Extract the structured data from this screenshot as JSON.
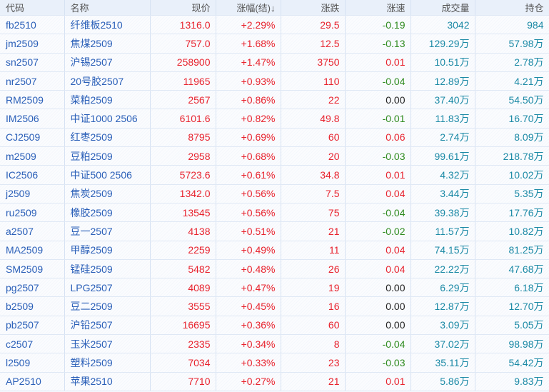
{
  "columns": [
    "代码",
    "名称",
    "现价",
    "涨幅(结)↓",
    "涨跌",
    "涨速",
    "成交量",
    "持仓"
  ],
  "rows": [
    [
      "fb2510",
      "纤维板2510",
      "1316.0",
      "+2.29%",
      "29.5",
      "-0.19",
      "3042",
      "984"
    ],
    [
      "jm2509",
      "焦煤2509",
      "757.0",
      "+1.68%",
      "12.5",
      "-0.13",
      "129.29万",
      "57.98万"
    ],
    [
      "sn2507",
      "沪锡2507",
      "258900",
      "+1.47%",
      "3750",
      "0.01",
      "10.51万",
      "2.78万"
    ],
    [
      "nr2507",
      "20号胶2507",
      "11965",
      "+0.93%",
      "110",
      "-0.04",
      "12.89万",
      "4.21万"
    ],
    [
      "RM2509",
      "菜粕2509",
      "2567",
      "+0.86%",
      "22",
      "0.00",
      "37.40万",
      "54.50万"
    ],
    [
      "IM2506",
      "中证1000 2506",
      "6101.6",
      "+0.82%",
      "49.8",
      "-0.01",
      "11.83万",
      "16.70万"
    ],
    [
      "CJ2509",
      "红枣2509",
      "8795",
      "+0.69%",
      "60",
      "0.06",
      "2.74万",
      "8.09万"
    ],
    [
      "m2509",
      "豆粕2509",
      "2958",
      "+0.68%",
      "20",
      "-0.03",
      "99.61万",
      "218.78万"
    ],
    [
      "IC2506",
      "中证500 2506",
      "5723.6",
      "+0.61%",
      "34.8",
      "0.01",
      "4.32万",
      "10.02万"
    ],
    [
      "j2509",
      "焦炭2509",
      "1342.0",
      "+0.56%",
      "7.5",
      "0.04",
      "3.44万",
      "5.35万"
    ],
    [
      "ru2509",
      "橡胶2509",
      "13545",
      "+0.56%",
      "75",
      "-0.04",
      "39.38万",
      "17.76万"
    ],
    [
      "a2507",
      "豆一2507",
      "4138",
      "+0.51%",
      "21",
      "-0.02",
      "11.57万",
      "10.82万"
    ],
    [
      "MA2509",
      "甲醇2509",
      "2259",
      "+0.49%",
      "11",
      "0.04",
      "74.15万",
      "81.25万"
    ],
    [
      "SM2509",
      "锰硅2509",
      "5482",
      "+0.48%",
      "26",
      "0.04",
      "22.22万",
      "47.68万"
    ],
    [
      "pg2507",
      "LPG2507",
      "4089",
      "+0.47%",
      "19",
      "0.00",
      "6.29万",
      "6.18万"
    ],
    [
      "b2509",
      "豆二2509",
      "3555",
      "+0.45%",
      "16",
      "0.00",
      "12.87万",
      "12.70万"
    ],
    [
      "pb2507",
      "沪铅2507",
      "16695",
      "+0.36%",
      "60",
      "0.00",
      "3.09万",
      "5.05万"
    ],
    [
      "c2507",
      "玉米2507",
      "2335",
      "+0.34%",
      "8",
      "-0.04",
      "37.02万",
      "98.98万"
    ],
    [
      "l2509",
      "塑料2509",
      "7034",
      "+0.33%",
      "23",
      "-0.03",
      "35.11万",
      "54.42万"
    ],
    [
      "AP2510",
      "苹果2510",
      "7710",
      "+0.27%",
      "21",
      "0.01",
      "5.86万",
      "9.83万"
    ]
  ]
}
